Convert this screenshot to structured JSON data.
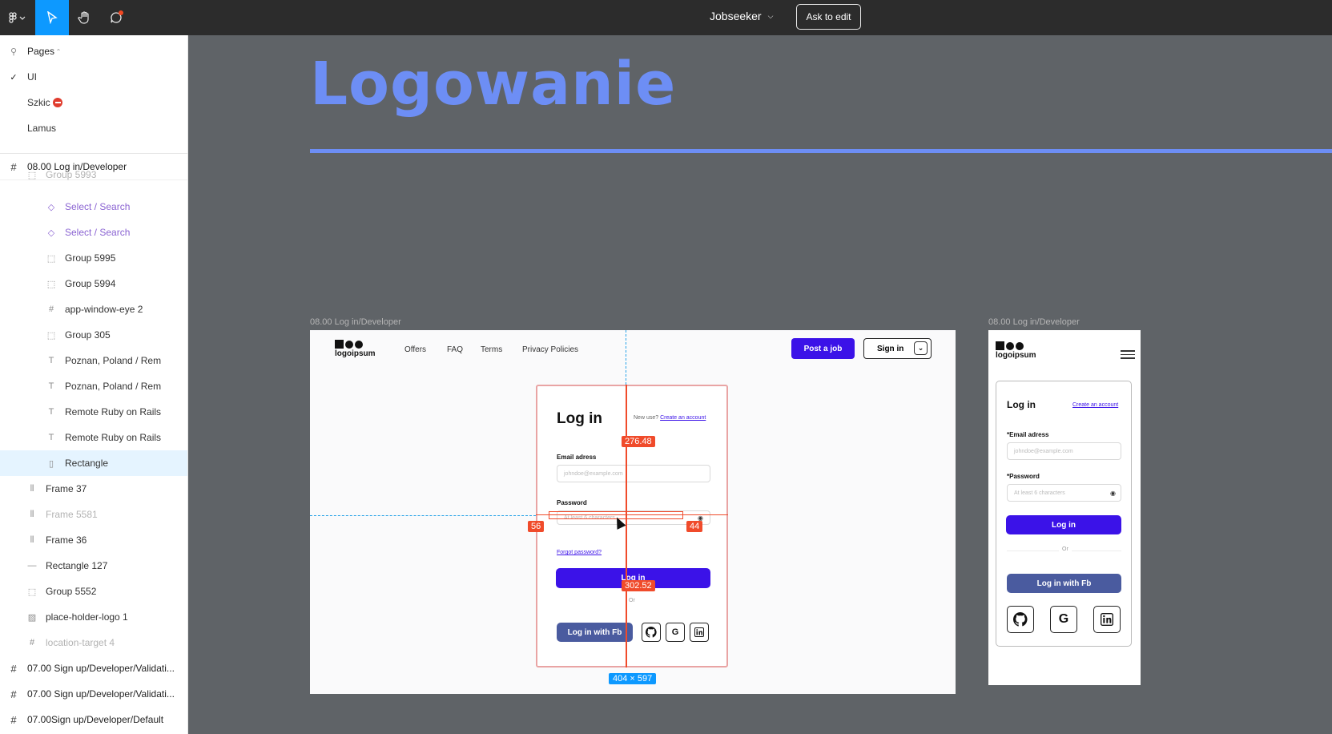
{
  "toolbar": {
    "file_title": "Jobseeker",
    "ask_to_edit": "Ask to edit"
  },
  "sidebar": {
    "pages_label": "Pages",
    "pages": [
      "UI",
      "Szkic",
      "Lamus"
    ],
    "current_frame": "08.00 Log in/Developer",
    "layers": [
      {
        "label": "Group 5993",
        "icon": "group-icon",
        "style": "grey"
      },
      {
        "label": "Select / Search",
        "icon": "component-instance-icon",
        "style": "purple"
      },
      {
        "label": "Select / Search",
        "icon": "component-instance-icon",
        "style": "purple"
      },
      {
        "label": "Group 5995",
        "icon": "group-icon",
        "style": "normal"
      },
      {
        "label": "Group 5994",
        "icon": "group-icon",
        "style": "normal"
      },
      {
        "label": "app-window-eye 2",
        "icon": "frame-icon",
        "style": "normal"
      },
      {
        "label": "Group 305",
        "icon": "group-icon",
        "style": "normal"
      },
      {
        "label": "Poznan, Poland / Rem",
        "icon": "text-icon",
        "style": "normal"
      },
      {
        "label": "Poznan, Poland / Rem",
        "icon": "text-icon",
        "style": "normal"
      },
      {
        "label": "Remote Ruby on Rails",
        "icon": "text-icon",
        "style": "normal"
      },
      {
        "label": "Remote Ruby on Rails",
        "icon": "text-icon",
        "style": "normal"
      },
      {
        "label": "Rectangle",
        "icon": "rectangle-icon",
        "style": "selected"
      }
    ],
    "layers_outer": [
      {
        "label": "Frame 37",
        "icon": "auto-layout-icon",
        "style": "normal"
      },
      {
        "label": "Frame 5581",
        "icon": "auto-layout-icon",
        "style": "grey"
      },
      {
        "label": "Frame 36",
        "icon": "auto-layout-icon",
        "style": "normal"
      },
      {
        "label": "Rectangle 127",
        "icon": "line-icon",
        "style": "normal"
      },
      {
        "label": "Group 5552",
        "icon": "group-icon",
        "style": "normal"
      },
      {
        "label": "place-holder-logo 1",
        "icon": "image-icon",
        "style": "normal"
      },
      {
        "label": "location-target 4",
        "icon": "frame-icon",
        "style": "grey"
      }
    ],
    "frames_bottom": [
      "07.00 Sign up/Developer/Validati...",
      "07.00 Sign up/Developer/Validati...",
      "07.00Sign up/Developer/Default"
    ]
  },
  "canvas": {
    "heading": "Logowanie",
    "desktop_frame_label": "08.00 Log in/Developer",
    "mobile_frame_label": "08.00 Log in/Developer",
    "selection_size": "404 × 597",
    "measure_top": "276.48",
    "measure_bottom": "302.52",
    "measure_left": "56",
    "measure_right": "44"
  },
  "desktop": {
    "logo_text": "logoipsum",
    "nav": [
      "Offers",
      "FAQ",
      "Terms",
      "Privacy Policies"
    ],
    "post_job": "Post a job",
    "sign_in": "Sign in",
    "title": "Log in",
    "new_user": "New use?",
    "create_account": "Create an account",
    "email_label": "Email adress",
    "email_placeholder": "johndoe@example.com",
    "password_label": "Password",
    "password_placeholder": "At least 6 characters",
    "forgot": "Forgot password?",
    "login_button": "Log in",
    "or": "Or",
    "fb_button": "Log in with Fb"
  },
  "mobile": {
    "logo_text": "logoipsum",
    "title": "Log in",
    "create_account": "Create an account",
    "email_label": "*Email adress",
    "email_placeholder": "johndoe@example.com",
    "password_label": "*Password",
    "password_placeholder": "At least 6 characters",
    "login_button": "Log in",
    "or": "Or",
    "fb_button": "Log in with Fb"
  },
  "colors": {
    "accent": "#3b12e8",
    "facebook": "#4a5b9f",
    "heading": "#6d8ef5",
    "figma_blue": "#0d99ff",
    "measure_red": "#f04b2b"
  }
}
